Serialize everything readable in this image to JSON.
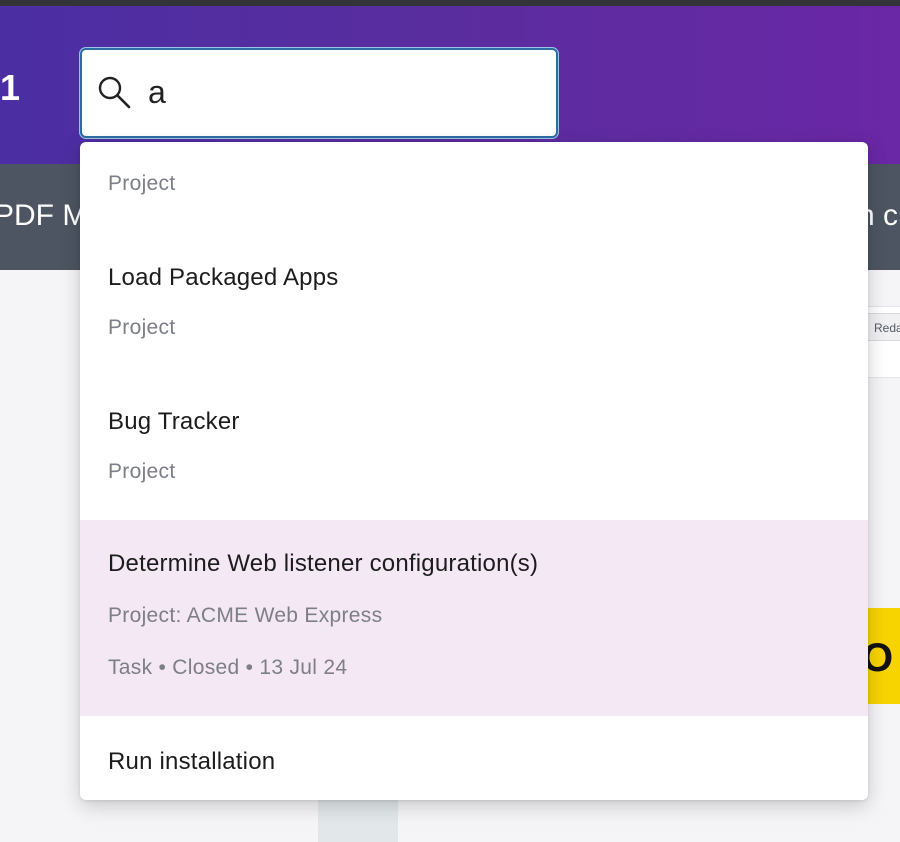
{
  "header": {
    "number": "1"
  },
  "subnav": {
    "left_text": "PDF M",
    "right_text": "n c"
  },
  "background": {
    "redact_label": "Reda",
    "yellow_char": "O"
  },
  "search": {
    "value": "a",
    "icon": "search-icon"
  },
  "results": [
    {
      "title": "",
      "meta": [
        "Project"
      ]
    },
    {
      "title": "Load Packaged Apps",
      "meta": [
        "Project"
      ]
    },
    {
      "title": "Bug Tracker",
      "meta": [
        "Project"
      ]
    },
    {
      "title": "Determine Web listener configuration(s)",
      "meta": [
        "Project: ACME Web Express",
        "Task • Closed • 13 Jul 24"
      ],
      "highlighted": true
    },
    {
      "title": "Run installation",
      "meta": []
    }
  ],
  "colors": {
    "header_start": "#4b2ea3",
    "header_end": "#6a27a6",
    "subnav": "#4c5561",
    "highlight": "#f3e8f4",
    "search_border": "#2e6da4"
  }
}
